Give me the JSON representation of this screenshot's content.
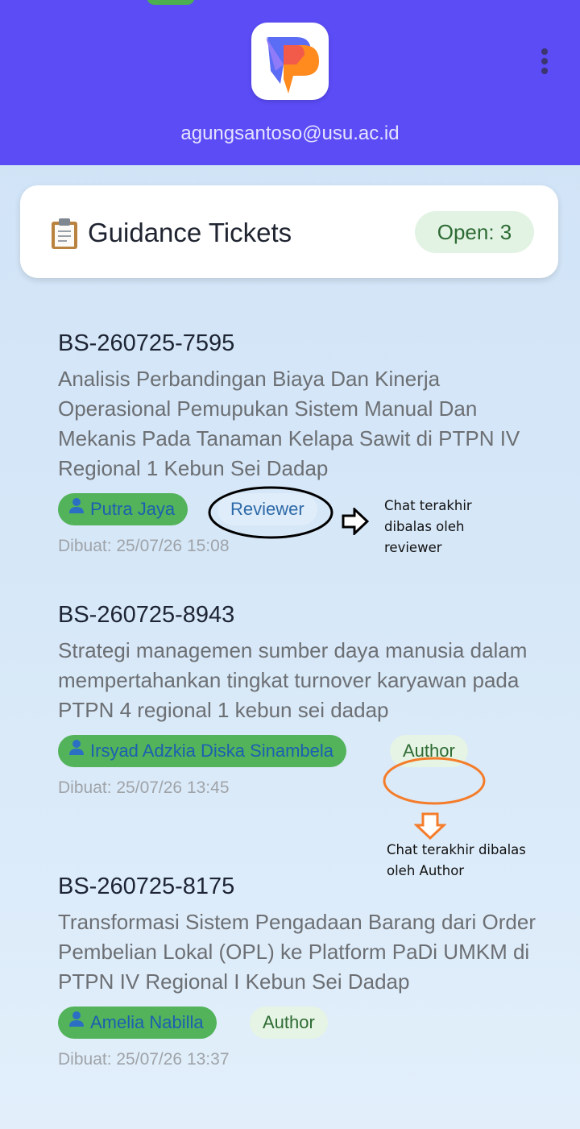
{
  "header": {
    "email": "agungsantoso@usu.ac.id",
    "color": "#5b4cf6",
    "logo_icon": "app-logo-icon",
    "menu_icon": "more-vertical-icon"
  },
  "summary": {
    "icon": "clipboard-icon",
    "title": "Guidance Tickets",
    "open_badge": "Open: 3"
  },
  "tickets": [
    {
      "id": "BS-260725-7595",
      "title": "Analisis Perbandingan Biaya Dan Kinerja Operasional Pemupukan Sistem Manual Dan Mekanis Pada Tanaman Kelapa Sawit di PTPN IV Regional 1 Kebun Sei Dadap",
      "user": "Putra Jaya",
      "role": "Reviewer",
      "date": "Dibuat: 25/07/26 15:08"
    },
    {
      "id": "BS-260725-8943",
      "title": "Strategi managemen sumber daya manusia dalam mempertahankan tingkat turnover karyawan pada PTPN 4 regional 1 kebun sei dadap",
      "user": "Irsyad Adzkia Diska Sinambela",
      "role": "Author",
      "date": "Dibuat: 25/07/26 13:45"
    },
    {
      "id": "BS-260725-8175",
      "title": "Transformasi Sistem Pengadaan Barang dari Order Pembelian Lokal (OPL) ke Platform PaDi UMKM di PTPN IV Regional I Kebun Sei Dadap",
      "user": "Amelia Nabilla",
      "role": "Author",
      "date": "Dibuat: 25/07/26 13:37"
    }
  ],
  "annotations": {
    "reviewer_note": "Chat terakhir dibalas oleh reviewer",
    "author_note": "Chat terakhir dibalas oleh Author",
    "reviewer_color": "#000000",
    "author_color": "#f47c2a"
  }
}
